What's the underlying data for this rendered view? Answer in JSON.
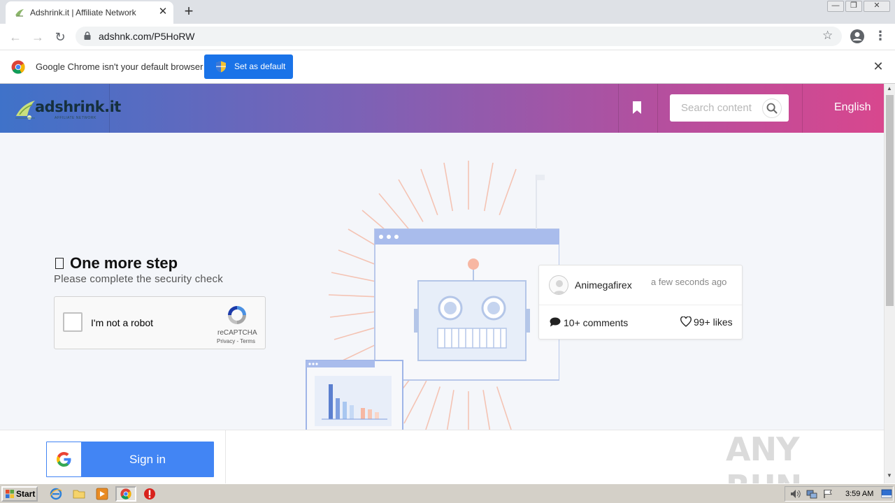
{
  "browser": {
    "tab": {
      "title": "Adshrink.it | Affiliate Network",
      "close": "✕"
    },
    "new_tab": "+",
    "window_buttons": {
      "minimize": "—",
      "restore": "❐",
      "close": "✕"
    },
    "nav": {
      "back": "←",
      "forward": "→",
      "reload": "↻"
    },
    "url": "adshnk.com/P5HoRW",
    "star": "☆",
    "menu": "⋮"
  },
  "infobar": {
    "message": "Google Chrome isn't your default browser",
    "button_label": "Set as default",
    "close": "✕"
  },
  "site": {
    "logo_text": "adshrink.it",
    "logo_sub": "AFFILIATE NETWORK",
    "search_placeholder": "Search content",
    "language": "English"
  },
  "challenge": {
    "title": "One more step",
    "subtitle": "Please complete the security check"
  },
  "recaptcha": {
    "label": "I'm not a robot",
    "brand": "reCAPTCHA",
    "links": "Privacy - Terms"
  },
  "card": {
    "username": "Animegafirex",
    "time": "a few seconds ago",
    "comments": "10+ comments",
    "likes": "99+ likes"
  },
  "footer": {
    "signin_label": "Sign in",
    "watermark": "ANY RUN"
  },
  "taskbar": {
    "start_label": "Start",
    "clock": "3:59 AM"
  },
  "colors": {
    "header_gradient_start": "#3f72c9",
    "header_gradient_end": "#d8478e",
    "primary_blue": "#1a73e8",
    "google_blue": "#4285f4"
  }
}
